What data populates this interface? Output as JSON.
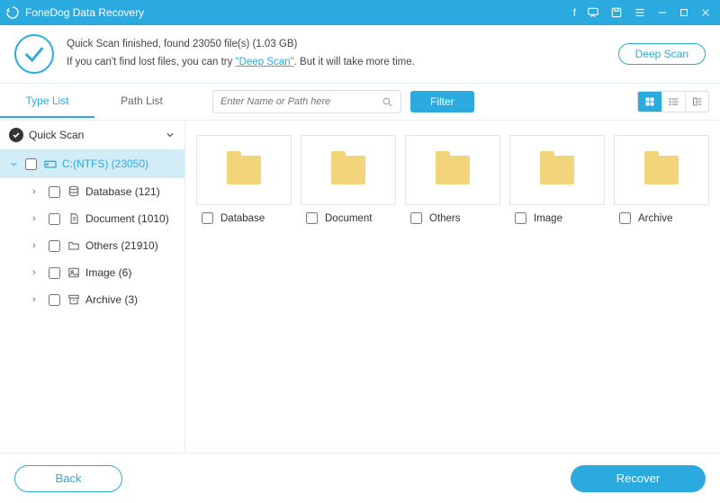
{
  "app": {
    "title": "FoneDog Data Recovery"
  },
  "status": {
    "line1_a": "Quick Scan finished, found ",
    "files_found": "23050",
    "line1_b": " file(s) (",
    "size": "1.03 GB",
    "line1_c": ")",
    "line2_a": "If you can't find lost files, you can try ",
    "deep_link": "\"Deep Scan\"",
    "line2_b": ". But it will take more time.",
    "deep_scan_btn": "Deep Scan"
  },
  "tabs": {
    "type": "Type List",
    "path": "Path List"
  },
  "search": {
    "placeholder": "Enter Name or Path here"
  },
  "filter": {
    "label": "Filter"
  },
  "sidebar": {
    "quick_scan": "Quick Scan",
    "drive": "C:(NTFS) (23050)",
    "items": [
      {
        "label": "Database (121)"
      },
      {
        "label": "Document (1010)"
      },
      {
        "label": "Others (21910)"
      },
      {
        "label": "Image (6)"
      },
      {
        "label": "Archive (3)"
      }
    ]
  },
  "cards": [
    {
      "label": "Database"
    },
    {
      "label": "Document"
    },
    {
      "label": "Others"
    },
    {
      "label": "Image"
    },
    {
      "label": "Archive"
    }
  ],
  "footer": {
    "back": "Back",
    "recover": "Recover"
  }
}
